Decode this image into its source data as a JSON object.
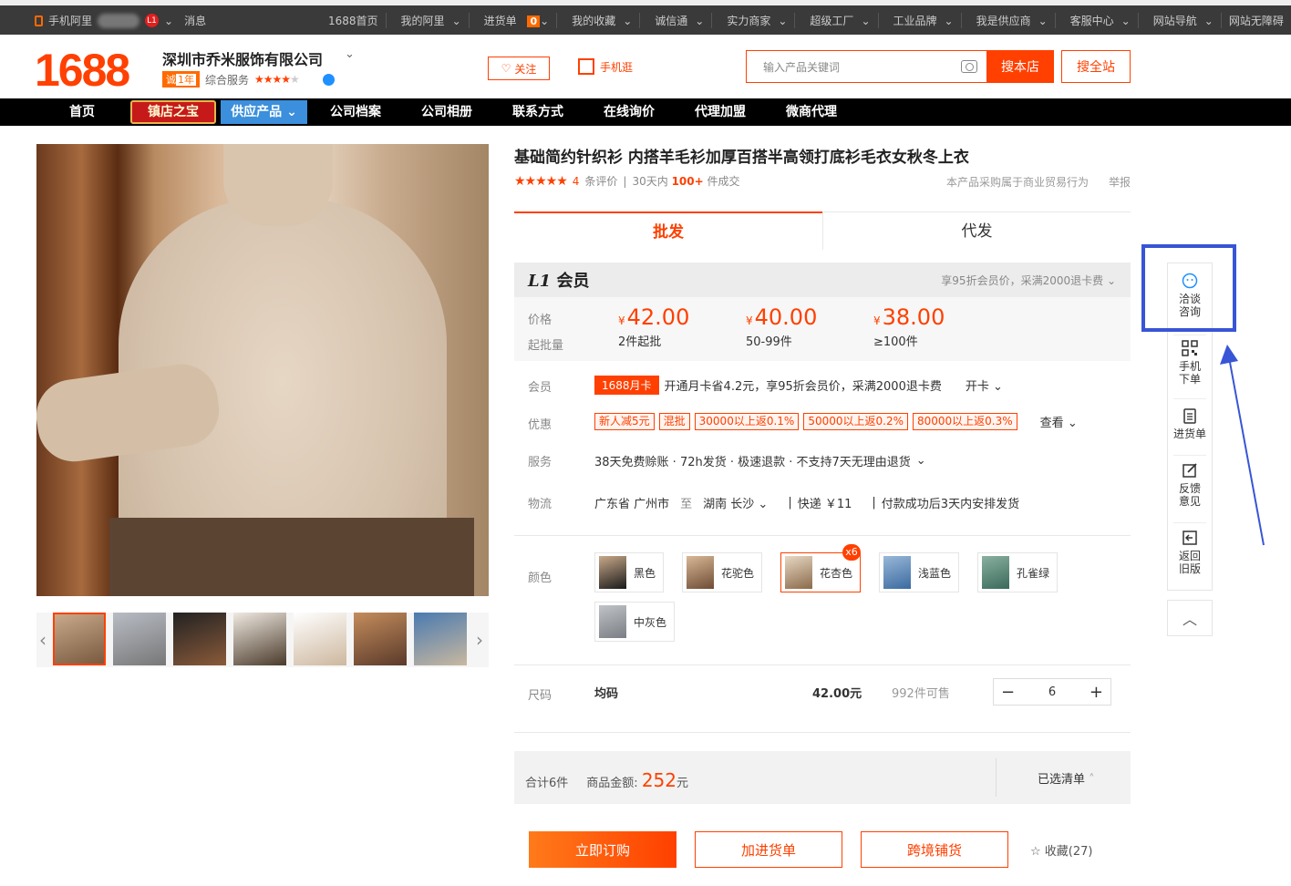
{
  "topbar": {
    "mobile": "手机阿里",
    "level": "L1",
    "messages": "消息",
    "links": [
      "1688首页",
      "我的阿里",
      "进货单",
      "我的收藏",
      "诚信通",
      "实力商家",
      "超级工厂",
      "工业品牌",
      "我是供应商",
      "客服中心",
      "网站导航",
      "网站无障碍"
    ],
    "cart_count": "0"
  },
  "header": {
    "logo": "1688",
    "company": "深圳市乔米服饰有限公司",
    "cheng_label": "诚",
    "cheng_years": "1年",
    "service_label": "综合服务",
    "follow": "关注",
    "mobile_shop": "手机逛",
    "search_placeholder": "输入产品关键词",
    "search_store": "搜本店",
    "search_site": "搜全站"
  },
  "nav": {
    "items": [
      "首页",
      "镇店之宝",
      "供应产品",
      "公司档案",
      "公司相册",
      "联系方式",
      "在线询价",
      "代理加盟",
      "微商代理"
    ]
  },
  "product": {
    "title": "基础简约针织衫 内搭羊毛衫加厚百搭半高领打底衫毛衣女秋冬上衣",
    "reviews_count": "4",
    "reviews_label": "条评价",
    "sold_prefix": "30天内",
    "sold_num": "100+",
    "sold_suffix": "件成交",
    "note": "本产品采购属于商业贸易行为",
    "report": "举报"
  },
  "tabs": {
    "wholesale": "批发",
    "dropship": "代发"
  },
  "pricing": {
    "member_title_l1": "L1",
    "member_title": "会员",
    "member_note": "享95折会员价，采满2000退卡费",
    "price_label": "价格",
    "moq_label": "起批量",
    "tiers": [
      {
        "price": "42.00",
        "qty": "2件起批"
      },
      {
        "price": "40.00",
        "qty": "50-99件"
      },
      {
        "price": "38.00",
        "qty": "≥100件"
      }
    ],
    "currency": "¥"
  },
  "attrs": {
    "member_label": "会员",
    "member_card": "1688月卡",
    "member_text": "开通月卡省4.2元，享95折会员价，采满2000退卡费",
    "open_card": "开卡",
    "promo_label": "优惠",
    "coupons": [
      "新人减5元",
      "混批",
      "30000以上返0.1%",
      "50000以上返0.2%",
      "80000以上返0.3%"
    ],
    "promo_more": "查看",
    "service_label": "服务",
    "service_text": "38天免费赊账 · 72h发货 · 极速退款 · 不支持7天无理由退货",
    "logistics_label": "物流",
    "from": "广东省 广州市",
    "to_word": "至",
    "to": "湖南 长沙",
    "express": "快递 ￥11",
    "ship_note": "付款成功后3天内安排发货"
  },
  "colors": {
    "label": "颜色",
    "items": [
      "黑色",
      "花驼色",
      "花杏色",
      "浅蓝色",
      "孔雀绿",
      "中灰色"
    ],
    "selected_badge": "x6"
  },
  "size": {
    "label": "尺码",
    "value": "均码",
    "price": "42.00元",
    "stock": "992件可售",
    "qty": "6"
  },
  "summary": {
    "total": "合计6件",
    "amount_label": "商品金额:",
    "amount": "252",
    "unit": "元",
    "list": "已选清单"
  },
  "actions": {
    "buy": "立即订购",
    "add_cart": "加进货单",
    "cross_border": "跨境铺货",
    "favorite": "收藏(27)"
  },
  "sidebar": {
    "items": [
      "洽谈咨询",
      "手机下单",
      "进货单",
      "反馈意见",
      "返回旧版"
    ]
  },
  "colors_theme": {
    "accent": "#ff4000",
    "highlight": "#3755d6"
  }
}
